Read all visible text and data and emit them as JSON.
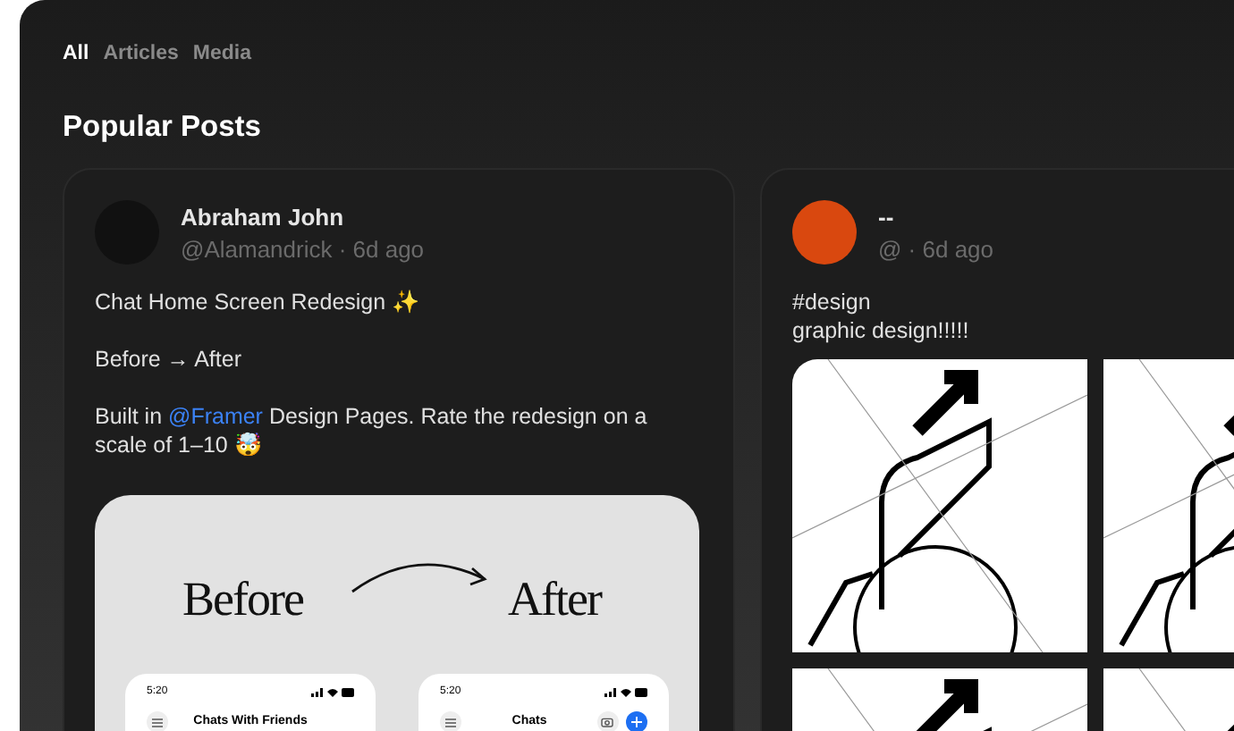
{
  "tabs": [
    {
      "label": "All",
      "selected": true
    },
    {
      "label": "Articles",
      "selected": false
    },
    {
      "label": "Media",
      "selected": false
    }
  ],
  "section_title": "Popular Posts",
  "posts": [
    {
      "name": "Abraham John",
      "meta": "@Alamandrick · 6d ago",
      "color": "#111111",
      "paragraphs": [
        [
          {
            "kind": "text",
            "text": "Chat Home Screen Redesign ✨"
          }
        ],
        [
          {
            "kind": "text",
            "text": "Before → After"
          }
        ],
        [
          {
            "kind": "text",
            "text": "Built in "
          },
          {
            "kind": "mention",
            "text": "@Framer"
          },
          {
            "kind": "text",
            "text": " Design Pages. Rate the redesign on a scale of 1–10 🤯"
          }
        ]
      ],
      "media": {
        "kind": "comparison",
        "before": "Before",
        "after": "After",
        "phones": [
          {
            "time": "5:20",
            "title": "Chats With Friends",
            "compose": false
          },
          {
            "time": "5:20",
            "title": "Chats",
            "compose": true
          }
        ]
      }
    },
    {
      "name": "--",
      "meta": "@ · 6d ago",
      "color": "#d9480f",
      "paragraphs": [
        [
          {
            "kind": "text",
            "text": "#design\ngraphic design!!!!!"
          }
        ]
      ],
      "media": {
        "kind": "gallery"
      }
    }
  ]
}
